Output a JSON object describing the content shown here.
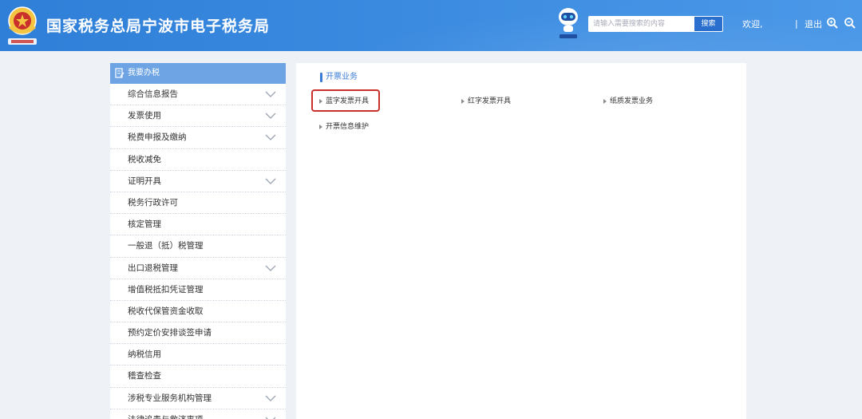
{
  "header": {
    "site_title": "国家税务总局宁波市电子税务局",
    "search_placeholder": "请输入需要搜索的内容",
    "search_button": "搜索",
    "welcome": "欢迎,",
    "divider": "|",
    "logout": "退出",
    "emblem_icon": "tax-emblem-icon",
    "robot_icon": "robot-assistant-icon",
    "brand_color": "#3a8ae0"
  },
  "sidebar": {
    "title": "我要办税",
    "items": [
      {
        "label": "综合信息报告",
        "expandable": true
      },
      {
        "label": "发票使用",
        "expandable": true
      },
      {
        "label": "税费申报及缴纳",
        "expandable": true
      },
      {
        "label": "税收减免",
        "expandable": false
      },
      {
        "label": "证明开具",
        "expandable": true
      },
      {
        "label": "税务行政许可",
        "expandable": false
      },
      {
        "label": "核定管理",
        "expandable": false
      },
      {
        "label": "一般退（抵）税管理",
        "expandable": false
      },
      {
        "label": "出口退税管理",
        "expandable": true
      },
      {
        "label": "增值税抵扣凭证管理",
        "expandable": false
      },
      {
        "label": "税收代保管资金收取",
        "expandable": false
      },
      {
        "label": "预约定价安排谈签申请",
        "expandable": false
      },
      {
        "label": "纳税信用",
        "expandable": false
      },
      {
        "label": "稽查检查",
        "expandable": false
      },
      {
        "label": "涉税专业服务机构管理",
        "expandable": true
      },
      {
        "label": "法律追责与救济事项",
        "expandable": true
      }
    ]
  },
  "main": {
    "section_title": "开票业务",
    "links": [
      {
        "label": "蓝字发票开具",
        "highlighted": true
      },
      {
        "label": "红字发票开具",
        "highlighted": false
      },
      {
        "label": "纸质发票业务",
        "highlighted": false
      },
      {
        "label": "开票信息维护",
        "highlighted": false
      }
    ],
    "highlight_color": "#c9302c"
  }
}
